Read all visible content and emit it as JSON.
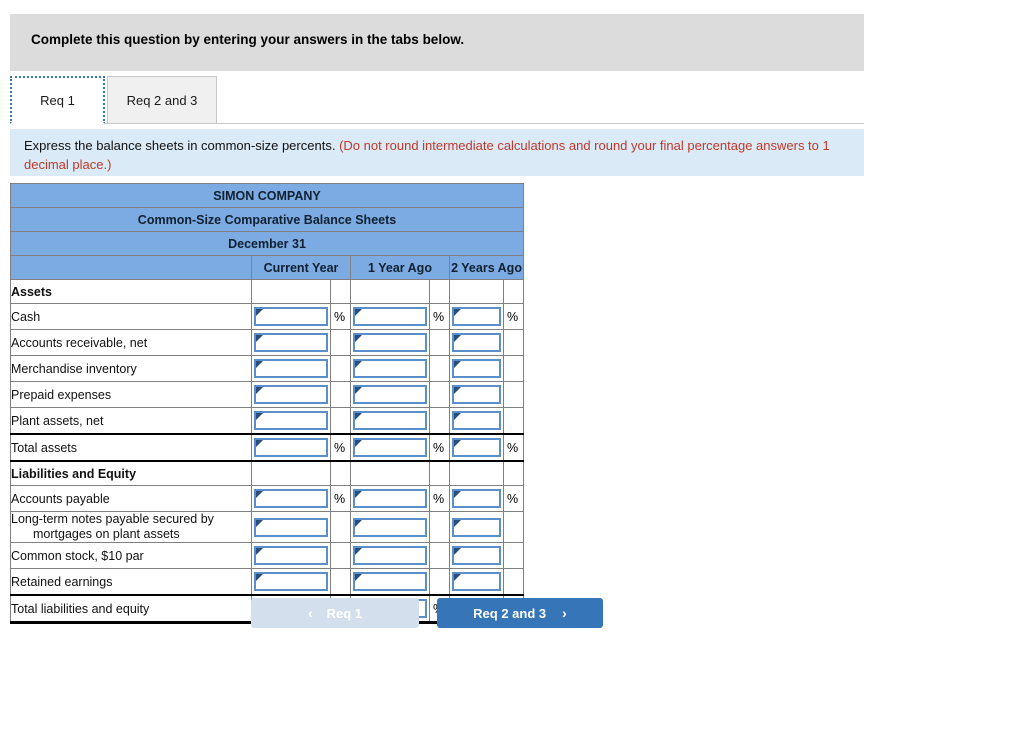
{
  "banner": {
    "text": "Complete this question by entering your answers in the tabs below."
  },
  "tabs": [
    {
      "label": "Req 1",
      "active": true
    },
    {
      "label": "Req 2 and 3",
      "active": false
    }
  ],
  "instruction": {
    "main": "Express the balance sheets in common-size percents.",
    "note": "(Do not round intermediate calculations and round your final percentage answers to 1 decimal place.)"
  },
  "sheet": {
    "company": "SIMON COMPANY",
    "statement": "Common-Size Comparative Balance Sheets",
    "period": "December 31",
    "columns": [
      "Current Year",
      "1 Year Ago",
      "2 Years Ago"
    ],
    "percent_symbol": "%",
    "rows": [
      {
        "label": "Assets",
        "type": "section"
      },
      {
        "label": "Cash",
        "type": "entry",
        "show_pct": true
      },
      {
        "label": "Accounts receivable, net",
        "type": "entry",
        "show_pct": false
      },
      {
        "label": "Merchandise inventory",
        "type": "entry",
        "show_pct": false
      },
      {
        "label": "Prepaid expenses",
        "type": "entry",
        "show_pct": false
      },
      {
        "label": "Plant assets, net",
        "type": "entry",
        "show_pct": false
      },
      {
        "label": "Total assets",
        "type": "total",
        "show_pct": true
      },
      {
        "label": "Liabilities and Equity",
        "type": "section"
      },
      {
        "label": "Accounts payable",
        "type": "entry",
        "show_pct": true
      },
      {
        "label": "Long-term notes payable secured by",
        "label_line2": "mortgages on plant assets",
        "type": "entry-2line",
        "show_pct": false
      },
      {
        "label": "Common stock, $10 par",
        "type": "entry",
        "show_pct": false
      },
      {
        "label": "Retained earnings",
        "type": "entry",
        "show_pct": false
      },
      {
        "label": "Total liabilities and equity",
        "type": "grand",
        "show_pct": true
      }
    ]
  },
  "nav": {
    "prev_label": "Req 1",
    "prev_chevron": "‹",
    "next_label": "Req 2 and 3",
    "next_chevron": "›"
  },
  "colors": {
    "header_blue": "#7cabe3",
    "banner_gray": "#dcdcdc",
    "instruction_blue": "#daeaf7",
    "note_red": "#c0392b",
    "button_blue": "#3575b8",
    "button_disabled": "#d3dfed",
    "entry_border": "#5b8fc9"
  }
}
